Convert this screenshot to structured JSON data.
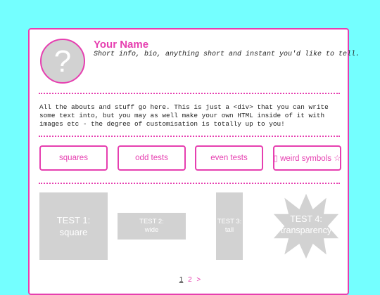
{
  "profile": {
    "avatar_glyph": "?",
    "name": "Your Name",
    "bio": "Short info, bio, anything short and instant you'd like to tell."
  },
  "about": {
    "text": "All the abouts and stuff go here. This is just a <div> that you can write some text into, but you may as well make your own HTML inside of it with images etc - the degree of customisation is totally up to you!"
  },
  "nav": [
    {
      "label": "squares"
    },
    {
      "label": "odd tests"
    },
    {
      "label": "even tests"
    },
    {
      "label": "▯ weird symbols ☆"
    }
  ],
  "gallery": {
    "tile1": {
      "line1": "TEST 1:",
      "line2": "square"
    },
    "tile2": {
      "line1": "TEST 2:",
      "line2": "wide"
    },
    "tile3": {
      "line1": "TEST 3:",
      "line2": "tall"
    },
    "tile4": {
      "line1": "TEST 4:",
      "line2": "transparency"
    }
  },
  "pager": {
    "current": "1",
    "next_page": "2",
    "next_arrow": ">"
  },
  "colors": {
    "background": "#74ffff",
    "accent": "#e63fb0",
    "tile": "#d2d2d2"
  }
}
